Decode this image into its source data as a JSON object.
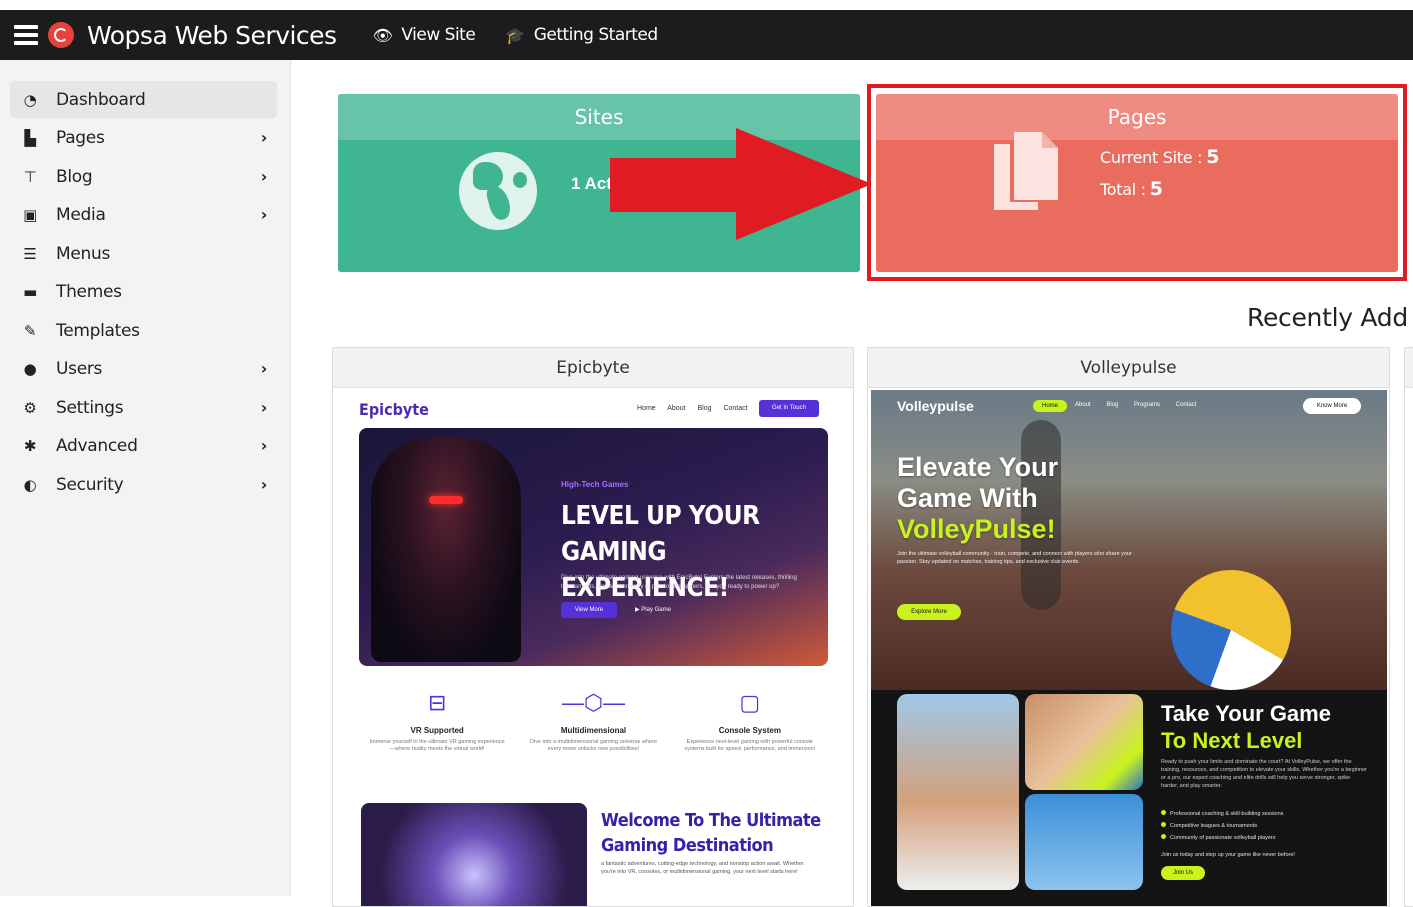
{
  "topbar": {
    "brand": "Wopsa Web Services",
    "view_site": "View Site",
    "getting_started": "Getting Started"
  },
  "sidebar": {
    "items": [
      {
        "label": "Dashboard",
        "icon": "dashboard-icon",
        "active": true
      },
      {
        "label": "Pages",
        "icon": "pages-icon",
        "has_submenu": true
      },
      {
        "label": "Blog",
        "icon": "pin-icon",
        "has_submenu": true
      },
      {
        "label": "Media",
        "icon": "media-icon",
        "has_submenu": true
      },
      {
        "label": "Menus",
        "icon": "list-icon"
      },
      {
        "label": "Themes",
        "icon": "paint-roller-icon"
      },
      {
        "label": "Templates",
        "icon": "brush-icon"
      },
      {
        "label": "Users",
        "icon": "user-icon",
        "has_submenu": true
      },
      {
        "label": "Settings",
        "icon": "cogs-icon",
        "has_submenu": true
      },
      {
        "label": "Advanced",
        "icon": "gear-icon",
        "has_submenu": true
      },
      {
        "label": "Security",
        "icon": "shield-icon",
        "has_submenu": true
      }
    ]
  },
  "cards": {
    "sites": {
      "title": "Sites",
      "text": "1 Act",
      "color": "#3fb592"
    },
    "pages": {
      "title": "Pages",
      "current_label": "Current Site : ",
      "current_value": "5",
      "total_label": "Total : ",
      "total_value": "5",
      "color": "#ea6c5f"
    }
  },
  "annotation": {
    "color": "#e01b22"
  },
  "recent": {
    "title": "Recently Add",
    "themes": [
      {
        "name": "Epicbyte",
        "preview": {
          "logo": "Epicbyte",
          "nav": [
            "Home",
            "About",
            "Blog",
            "Contact"
          ],
          "cta": "Get In Touch",
          "tag": "High-Tech Games",
          "headline1": "LEVEL UP YOUR",
          "headline2": "GAMING EXPERIENCE!",
          "body": "Dive into the ultimate gaming universe with EpicByte! Explore the latest releases, thrilling tournaments, and a community of passionate gamers. Are you ready to power up?",
          "btn": "View More",
          "play": "Play Game",
          "features": [
            {
              "title": "VR Supported",
              "desc": "Immerse yourself in the ultimate VR gaming experience—where reality meets the virtual world!"
            },
            {
              "title": "Multidimensional",
              "desc": "Dive into a multidimensional gaming universe where every move unlocks new possibilities!"
            },
            {
              "title": "Console System",
              "desc": "Experience next-level gaming with powerful console systems built for speed, performance, and immersion!"
            }
          ],
          "welcome1": "Welcome To The Ultimate",
          "welcome2": "Gaming Destination",
          "welcome_text": "a fantastic adventures, cutting-edge technology, and nonstop action await. Whether you're into VR, consoles, or multidimensional gaming, your next level starts here!"
        }
      },
      {
        "name": "Volleypulse",
        "preview": {
          "logo": "Volleypulse",
          "nav_active": "Home",
          "nav": [
            "About",
            "Blog",
            "Programs",
            "Contact"
          ],
          "cta": "Know More",
          "title1": "Elevate Your",
          "title2": "Game With",
          "title3": "VolleyPulse!",
          "sub": "Join the ultimate volleyball community - train, compete, and connect with players who share your passion. Stay updated on matches, training tips, and exclusive club events.",
          "btn": "Explore More",
          "take1": "Take Your Game",
          "take2": "To Next Level",
          "take_text": "Ready to push your limits and dominate the court? At VolleyPulse, we offer the training, resources, and competition to elevate your skills. Whether you're a beginner or a pro, our expert coaching and elite drills will help you serve stronger, spike harder, and play smarter.",
          "bullets": [
            "Professional coaching & skill-building sessions",
            "Competitive leagues & tournaments",
            "Community of passionate volleyball players"
          ],
          "join": "Join us today and step up your game like never before!",
          "join_btn": "Join Us"
        }
      }
    ]
  }
}
